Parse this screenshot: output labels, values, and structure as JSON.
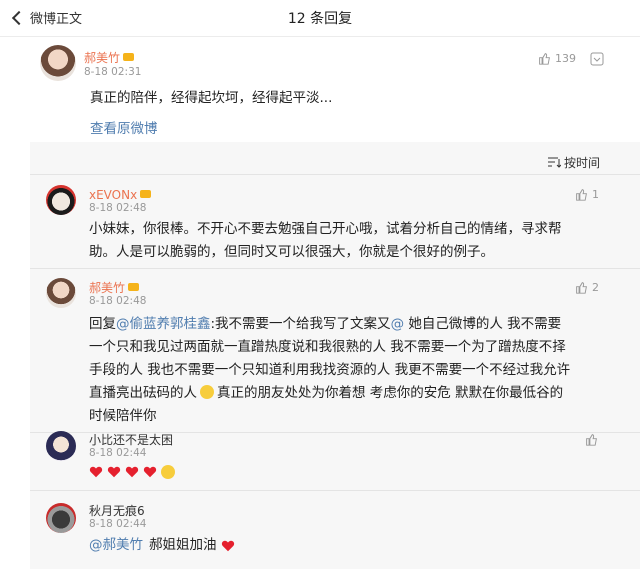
{
  "header": {
    "back_label": "微博正文",
    "title": "12 条回复"
  },
  "main_comment": {
    "username": "郝美竹",
    "time": "8-18 02:31",
    "text": "真正的陪伴，经得起坎坷，经得起平淡...",
    "likes": "139",
    "view_original": "查看原微博"
  },
  "sort": {
    "label": "按时间"
  },
  "replies": [
    {
      "username": "xEVONx",
      "time": "8-18 02:48",
      "likes": "1",
      "text_line1": "小妹妹，你很棒。不开心不要去勉强自己开心哦，试着分析自己的情绪，寻求帮",
      "text_line2": "助。人是可以脆弱的，但同时又可以很强大，你就是个很好的例子。"
    },
    {
      "username": "郝美竹",
      "time": "8-18 02:48",
      "likes": "2",
      "reply_prefix": "回复",
      "mention": "@偷蓝养郭桂鑫",
      "text_line1": ":我不需要一个给我写了文案又",
      "mention2": "@",
      "text_line1b": " 她自己微博的人 我不需要",
      "text_line2": "一个只和我见过两面就一直蹭热度说和我很熟的人 我不需要一个为了蹭热度不择",
      "text_line3": "手段的人 我也不需要一个只知道利用我找资源的人 我更不需要一个不经过我允许",
      "text_line4": "直播亮出砝码的人",
      "text_line4b": "真正的朋友处处为你着想 考虑你的安危 默默在你最低谷的",
      "text_line5": "时候陪伴你"
    },
    {
      "username": "小比还不是太困",
      "time": "8-18 02:44"
    },
    {
      "username": "秋月无痕6",
      "time": "8-18 02:44",
      "mention": "@郝美竹",
      "text": "郝姐姐加油"
    }
  ]
}
